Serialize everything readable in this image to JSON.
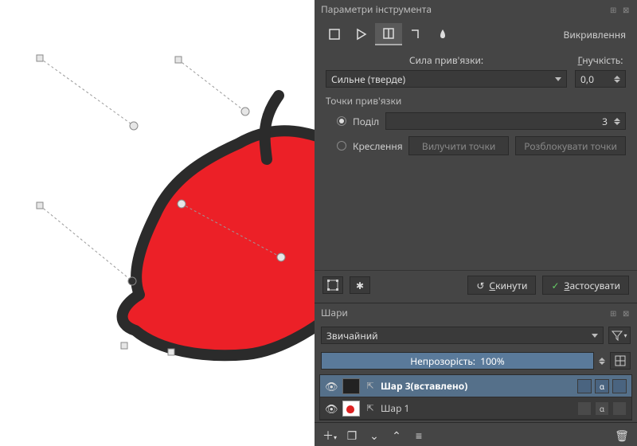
{
  "tool_options": {
    "title": "Параметри інструмента",
    "active_tab_label": "Викривлення",
    "binding_strength_label": "Сила прив'язки:",
    "binding_strength_value": "Сильне (тверде)",
    "flex_label_prefix": "Г",
    "flex_label_rest": "нучкість:",
    "flex_value": "0,0",
    "anchors_label": "Точки прив'язки",
    "radios": {
      "subdiv": {
        "label": "Поділ",
        "value": "3",
        "checked": true
      },
      "draw": {
        "label": "Креслення",
        "checked": false
      }
    },
    "buttons": {
      "remove_points": "Вилучити точки",
      "unlock_points": "Розблокувати точки",
      "reset_prefix": "С",
      "reset_rest": "кинути",
      "apply_prefix": "З",
      "apply_rest": "астосувати"
    }
  },
  "layers_panel": {
    "title": "Шари",
    "blend_mode": "Звичайний",
    "opacity_label": "Непрозорість:",
    "opacity_value": "100%",
    "layers": [
      {
        "name": "Шар 3(вставлено)",
        "selected": true,
        "thumb": "blank-dark"
      },
      {
        "name": "Шар 1",
        "selected": false,
        "thumb": "mini-apple"
      }
    ]
  },
  "icons": {
    "reset": "↺",
    "apply": "✓",
    "funnel": "▾",
    "eye": "👁",
    "trash": "🗑",
    "plus": "＋",
    "stack": "❐",
    "down": "⌄",
    "up": "⌃",
    "copy": "❏",
    "sliders": "≡",
    "transform_bounds": "▣",
    "bug": "✱"
  }
}
